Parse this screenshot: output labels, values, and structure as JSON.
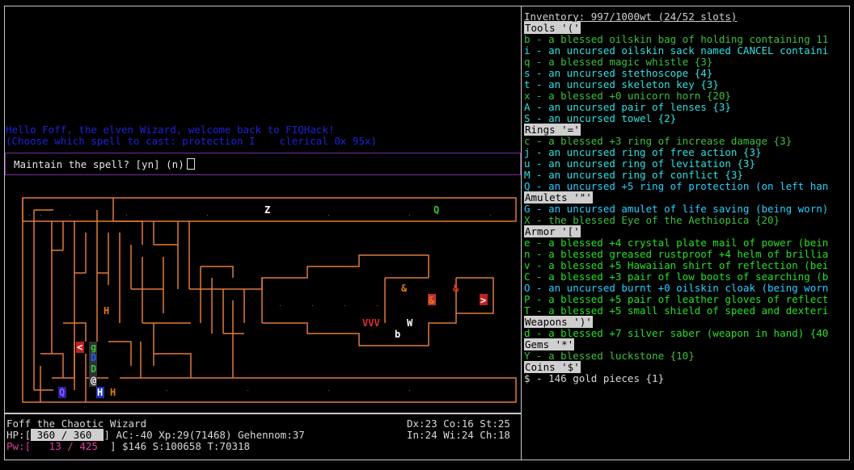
{
  "messages": {
    "welcome": "Hello Foff, the elven Wizard, welcome back to FIQHack!",
    "spell_menu": "(Choose which spell to cast: protection I    clerical 0x 95x)"
  },
  "prompt": {
    "text": "Maintain the spell? [yn] (n)"
  },
  "status": {
    "name_line": "Foff the Chaotic Wizard",
    "hp_label": "HP:[",
    "hp_value": " 360 / 360  ",
    "hp_close": "]",
    "ac_line": "AC:-40 Xp:29(71468) Gehennom:37",
    "pw_label": "Pw:[",
    "pw_value": "   13 / 425  ",
    "pw_close": "]",
    "gold_line": "$146 S:100658 T:70318",
    "attr1": "Dx:23 Co:16 St:25",
    "attr2": "In:24 Wi:24 Ch:18"
  },
  "inventory": {
    "title": "Inventory: 997/1000wt (24/52 slots)",
    "sections": [
      {
        "header": "Tools '('",
        "items": [
          {
            "text": "b - a blessed oilskin bag of holding containing 11",
            "color": "#3cbf3c"
          },
          {
            "text": "i - an uncursed oilskin sack named CANCEL containi",
            "color": "#2fe0e0"
          },
          {
            "text": "q - a blessed magic whistle {3}",
            "color": "#3cbf3c"
          },
          {
            "text": "s - an uncursed stethoscope {4}",
            "color": "#2fe0e0"
          },
          {
            "text": "t - an uncursed skeleton key {3}",
            "color": "#2fe0e0"
          },
          {
            "text": "x - a blessed +0 unicorn horn {20}",
            "color": "#3cbf3c"
          },
          {
            "text": "A - an uncursed pair of lenses {3}",
            "color": "#2fe0e0"
          },
          {
            "text": "S - an uncursed towel {2}",
            "color": "#2fe0e0"
          }
        ]
      },
      {
        "header": "Rings '='",
        "items": [
          {
            "text": "c - a blessed +3 ring of increase damage {3}",
            "color": "#3cbf3c"
          },
          {
            "text": "j - an uncursed ring of free action {3}",
            "color": "#2fe0e0"
          },
          {
            "text": "u - an uncursed ring of levitation {3}",
            "color": "#2fe0e0"
          },
          {
            "text": "M - an uncursed ring of conflict {3}",
            "color": "#2fe0e0"
          },
          {
            "text": "Q - an uncursed +5 ring of protection (on left han",
            "color": "#25d0ff"
          }
        ]
      },
      {
        "header": "Amulets '\"'",
        "items": [
          {
            "text": "G - an uncursed amulet of life saving (being worn)",
            "color": "#25d0ff"
          },
          {
            "text": "X - the blessed Eye of the Aethiopica {20}",
            "color": "#3cbf3c"
          }
        ]
      },
      {
        "header": "Armor '['",
        "items": [
          {
            "text": "e - a blessed +4 crystal plate mail of power (bein",
            "color": "#25e025"
          },
          {
            "text": "n - a blessed greased rustproof +4 helm of brillia",
            "color": "#25e025"
          },
          {
            "text": "v - a blessed +5 Hawaiian shirt of reflection (bei",
            "color": "#25e025"
          },
          {
            "text": "C - a blessed +3 pair of low boots of searching (b",
            "color": "#25e025"
          },
          {
            "text": "O - an uncursed burnt +0 oilskin cloak (being worn",
            "color": "#25d0ff"
          },
          {
            "text": "P - a blessed +5 pair of leather gloves of reflect",
            "color": "#25e025"
          },
          {
            "text": "T - a blessed +5 small shield of speed and dexteri",
            "color": "#25e025"
          }
        ]
      },
      {
        "header": "Weapons ')'",
        "items": [
          {
            "text": "d - a blessed +7 silver saber (weapon in hand) {40",
            "color": "#25e025"
          }
        ]
      },
      {
        "header": "Gems '*'",
        "items": [
          {
            "text": "Y - a blessed luckstone {10}",
            "color": "#3cbf3c"
          }
        ]
      },
      {
        "header": "Coins '$'",
        "items": [
          {
            "text": "$ - 146 gold pieces {1}",
            "color": "#d8d8d8"
          }
        ]
      }
    ]
  },
  "map": {
    "glyphs": [
      {
        "ch": "Z",
        "color": "#ffffff",
        "name": "zombie-glyph"
      },
      {
        "ch": "Q",
        "color": "#3cbf3c",
        "name": "quantum-mechanic-glyph"
      },
      {
        "ch": "&",
        "color": "#e07a1a",
        "name": "demon-glyph"
      },
      {
        "ch": "&",
        "color": "#e03030",
        "name": "demon-glyph-red"
      },
      {
        "ch": "&",
        "color": "#e07a1a",
        "name": "demon-glyph-highlighted"
      },
      {
        "ch": ">",
        "color": "#ffffff",
        "name": "downstairs-glyph"
      },
      {
        "ch": "H",
        "color": "#e07a1a",
        "name": "giant-glyph"
      },
      {
        "ch": "VVV",
        "color": "#e03030",
        "name": "vampire-glyphs"
      },
      {
        "ch": "W",
        "color": "#ffffff",
        "name": "wraith-glyph"
      },
      {
        "ch": "b",
        "color": "#ffffff",
        "name": "blob-glyph"
      },
      {
        "ch": "<",
        "color": "#ffffff",
        "name": "upstairs-glyph"
      },
      {
        "ch": "g",
        "color": "#3cbf3c",
        "name": "gnome-glyph"
      },
      {
        "ch": "D",
        "color": "#2060ff",
        "name": "dragon-glyph"
      },
      {
        "ch": "D",
        "color": "#3cbf3c",
        "name": "dragon-glyph-green"
      },
      {
        "ch": "@",
        "color": "#ffffff",
        "name": "player-glyph"
      },
      {
        "ch": "Q",
        "color": "#8060ff",
        "name": "quantum-glyph-purple"
      },
      {
        "ch": "H",
        "color": "#ffffff",
        "name": "giant-glyph-white"
      },
      {
        "ch": "H",
        "color": "#e07a1a",
        "name": "giant-glyph-orange"
      }
    ]
  }
}
